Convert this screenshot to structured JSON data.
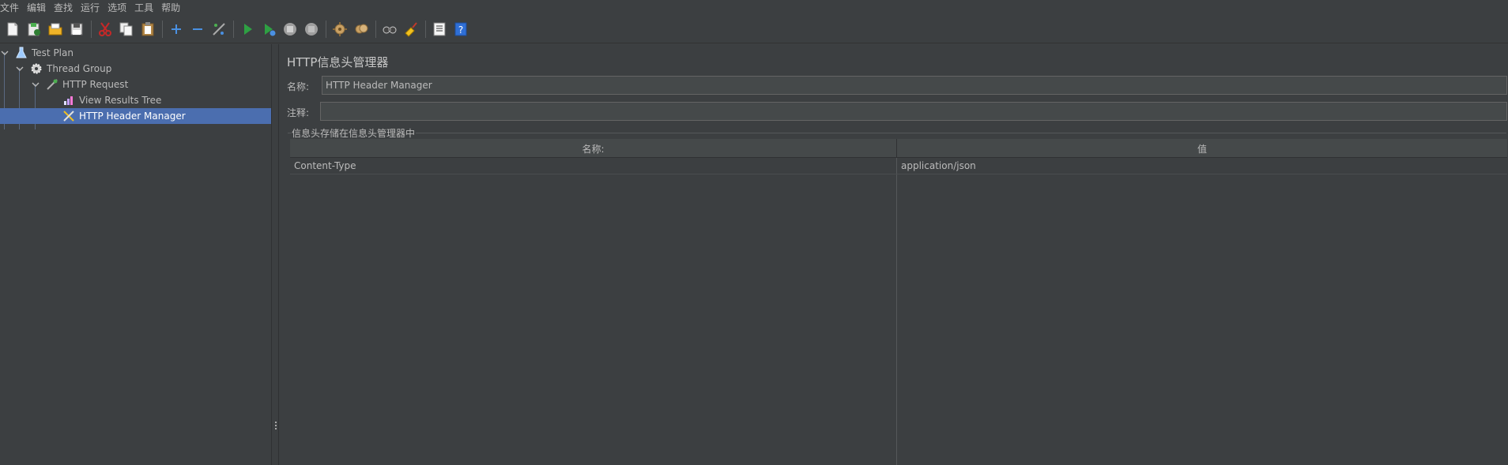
{
  "menubar": {
    "items": [
      "文件",
      "编辑",
      "查找",
      "运行",
      "选项",
      "工具",
      "帮助"
    ]
  },
  "toolbar": {
    "buttons": [
      {
        "icon": "new-file-icon"
      },
      {
        "icon": "templates-icon"
      },
      {
        "icon": "open-icon"
      },
      {
        "icon": "save-icon"
      },
      {
        "icon": "cut-icon"
      },
      {
        "icon": "copy-icon"
      },
      {
        "icon": "paste-icon"
      },
      {
        "icon": "expand-icon"
      },
      {
        "icon": "collapse-icon"
      },
      {
        "icon": "toggle-icon"
      },
      {
        "icon": "start-icon"
      },
      {
        "icon": "start-no-pauses-icon"
      },
      {
        "icon": "stop-icon"
      },
      {
        "icon": "shutdown-icon"
      },
      {
        "icon": "clear-icon"
      },
      {
        "icon": "clear-all-icon"
      },
      {
        "icon": "search-icon"
      },
      {
        "icon": "reset-search-icon"
      },
      {
        "icon": "function-helper-icon"
      },
      {
        "icon": "help-icon"
      }
    ]
  },
  "tree": {
    "items": [
      {
        "label": "Test Plan",
        "icon": "test-plan-icon"
      },
      {
        "label": "Thread Group",
        "icon": "thread-group-icon"
      },
      {
        "label": "HTTP Request",
        "icon": "http-request-icon"
      },
      {
        "label": "View Results Tree",
        "icon": "view-results-tree-icon"
      },
      {
        "label": "HTTP Header Manager",
        "icon": "header-manager-icon"
      }
    ]
  },
  "panel": {
    "title": "HTTP信息头管理器",
    "name_label": "名称:",
    "name_value": "HTTP Header Manager",
    "comment_label": "注释:",
    "comment_value": "",
    "group_title": "信息头存储在信息头管理器中",
    "table": {
      "columns": [
        "名称:",
        "值"
      ],
      "rows": [
        {
          "name": "Content-Type",
          "value": "application/json"
        }
      ]
    }
  },
  "colors": {
    "background": "#3c3f41",
    "selection": "#4b6eaf",
    "field": "#45494a"
  }
}
